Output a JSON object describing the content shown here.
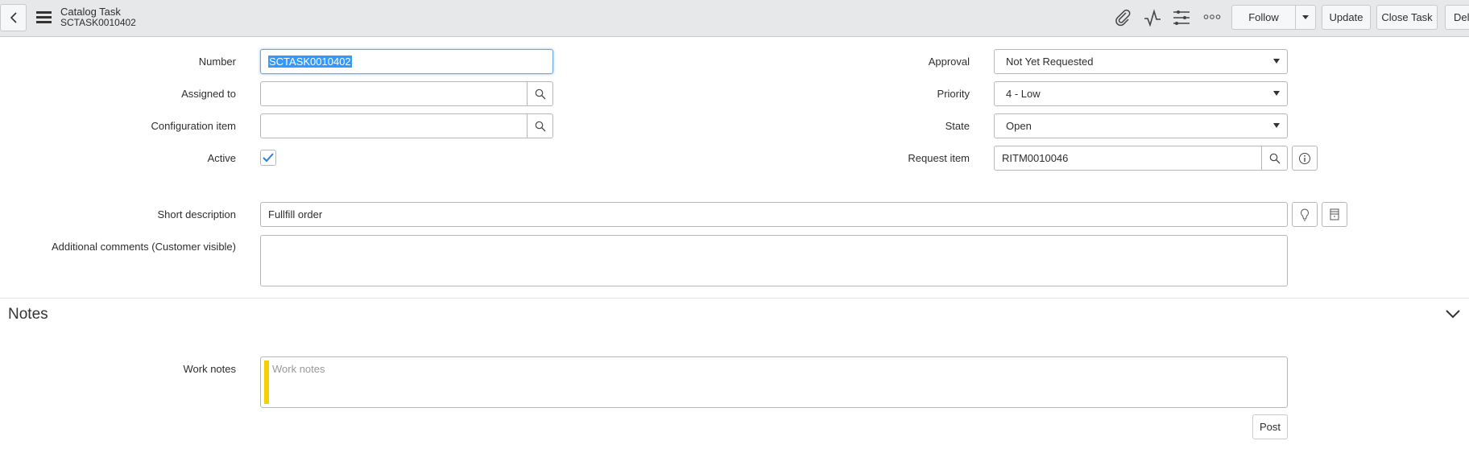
{
  "header": {
    "title": "Catalog Task",
    "subtitle": "SCTASK0010402",
    "follow": "Follow",
    "update": "Update",
    "close_task": "Close Task",
    "delete": "Dele"
  },
  "form": {
    "number": {
      "label": "Number",
      "value": "SCTASK0010402"
    },
    "assigned_to": {
      "label": "Assigned to",
      "value": ""
    },
    "configuration_item": {
      "label": "Configuration item",
      "value": ""
    },
    "active": {
      "label": "Active",
      "checked": true
    },
    "approval": {
      "label": "Approval",
      "value": "Not Yet Requested"
    },
    "priority": {
      "label": "Priority",
      "value": "4 - Low"
    },
    "state": {
      "label": "State",
      "value": "Open"
    },
    "request_item": {
      "label": "Request item",
      "value": "RITM0010046"
    },
    "short_description": {
      "label": "Short description",
      "value": "Fullfill order"
    },
    "additional_comments": {
      "label": "Additional comments (Customer visible)",
      "value": ""
    }
  },
  "notes": {
    "title": "Notes",
    "work_notes_label": "Work notes",
    "work_notes_placeholder": "Work notes",
    "post": "Post"
  },
  "colors": {
    "accent": "#2e7de1",
    "work_notes_bar": "#f5d000",
    "header_bg": "#e6e8ea"
  }
}
